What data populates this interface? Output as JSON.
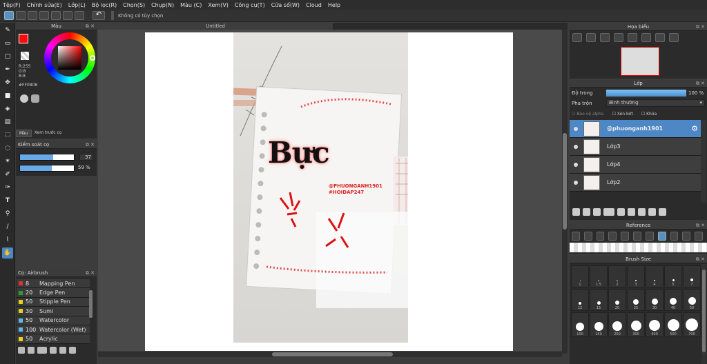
{
  "menu": [
    "Tệp(F)",
    "Chỉnh sửa(E)",
    "Lớp(L)",
    "Bộ lọc(R)",
    "Chọn(S)",
    "Chụp(N)",
    "Màu (C)",
    "Xem(V)",
    "Công cụ(T)",
    "Cửa sổ(W)",
    "Cloud",
    "Help"
  ],
  "toolbar": {
    "selection_label": "Không có tùy chọn"
  },
  "color_panel": {
    "title": "Màu",
    "r": "R:255",
    "g": "G:8",
    "b": "B:8",
    "hex": "#FF0808",
    "tab_color": "Màu",
    "tab_preview": "Xem trước cọ",
    "primary": "#ff0808"
  },
  "brush_control": {
    "title": "Kiểm soát cọ",
    "size": "37",
    "opacity": "59 %",
    "size_pct": 0.62,
    "opacity_pct": 0.59
  },
  "brush_list": {
    "title": "Cọ: Airbrush",
    "items": [
      {
        "n": "8",
        "name": "Mapping Pen",
        "color": "#e03030"
      },
      {
        "n": "20",
        "name": "Edge Pen",
        "color": "#2aa02a"
      },
      {
        "n": "50",
        "name": "Stipple Pen",
        "color": "#e8d020"
      },
      {
        "n": "30",
        "name": "Sumi",
        "color": "#e8d020"
      },
      {
        "n": "50",
        "name": "Watercolor",
        "color": "#60b8e8"
      },
      {
        "n": "100",
        "name": "Watercolor (Wet)",
        "color": "#60b8e8"
      },
      {
        "n": "50",
        "name": "Acrylic",
        "color": "#e8d020"
      }
    ]
  },
  "canvas": {
    "tab": "Untitled",
    "title_text": "Bực",
    "handle1": "@PHUONGANH1901",
    "handle2": "#HOIDAP247"
  },
  "navigator": {
    "title": "Họa biểu"
  },
  "layers": {
    "title": "Lớp",
    "opacity_label": "Độ trong",
    "opacity_value": "100 %",
    "blend_label": "Pha trộn",
    "blend_value": "Bình thường",
    "protect_alpha": "Bảo vệ alpha",
    "clipping": "Xén bớt",
    "lock": "Khóa",
    "items": [
      {
        "name": "@phuonganh1901"
      },
      {
        "name": "Lớp3"
      },
      {
        "name": "Lớp4"
      },
      {
        "name": "Lớp2"
      }
    ]
  },
  "reference": {
    "title": "Reference"
  },
  "brush_size": {
    "title": "Brush Size",
    "row1": [
      "1",
      "1.5",
      "2",
      "3",
      "4",
      "5",
      "7"
    ],
    "row2": [
      "12",
      "15",
      "20",
      "25",
      "30",
      "40",
      "50"
    ],
    "row3": [
      "100",
      "150",
      "200",
      "300",
      "400",
      "500",
      "700"
    ]
  }
}
